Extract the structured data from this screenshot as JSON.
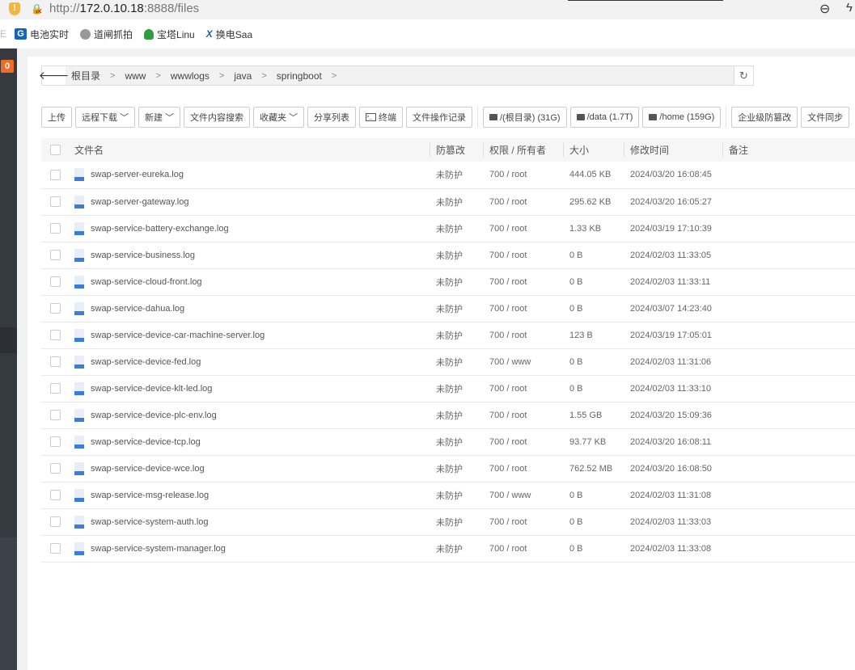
{
  "browser": {
    "url_prefix": "http://",
    "url_host": "172.0.10.18",
    "url_rest": ":8888/files",
    "bookmarks": [
      {
        "label": "电池实时",
        "icon": "g-logo"
      },
      {
        "label": "道闸抓拍",
        "icon": "globe-icon"
      },
      {
        "label": "宝塔Linu",
        "icon": "bt-icon"
      },
      {
        "label": "换电Saa",
        "icon": "x-logo"
      }
    ],
    "bookmark_cut": "E"
  },
  "sidebar": {
    "badge": "0"
  },
  "breadcrumb": [
    "根目录",
    "www",
    "wwwlogs",
    "java",
    "springboot"
  ],
  "toolbar": {
    "upload": "上传",
    "remote_download": "远程下载",
    "new": "新建",
    "content_search": "文件内容搜索",
    "favorites": "收藏夹",
    "share_list": "分享列表",
    "terminal": "终端",
    "op_log": "文件操作记录",
    "disks": [
      "/(根目录) (31G)",
      "/data (1.7T)",
      "/home (159G)"
    ],
    "tamper": "企业级防篡改",
    "sync": "文件同步"
  },
  "table": {
    "headers": [
      "文件名",
      "防篡改",
      "权限 / 所有者",
      "大小",
      "修改时间",
      "备注"
    ],
    "rows": [
      [
        "swap-server-eureka.log",
        "未防护",
        "700 / root",
        "444.05 KB",
        "2024/03/20 16:08:45"
      ],
      [
        "swap-server-gateway.log",
        "未防护",
        "700 / root",
        "295.62 KB",
        "2024/03/20 16:05:27"
      ],
      [
        "swap-service-battery-exchange.log",
        "未防护",
        "700 / root",
        "1.33 KB",
        "2024/03/19 17:10:39"
      ],
      [
        "swap-service-business.log",
        "未防护",
        "700 / root",
        "0 B",
        "2024/02/03 11:33:05"
      ],
      [
        "swap-service-cloud-front.log",
        "未防护",
        "700 / root",
        "0 B",
        "2024/02/03 11:33:11"
      ],
      [
        "swap-service-dahua.log",
        "未防护",
        "700 / root",
        "0 B",
        "2024/03/07 14:23:40"
      ],
      [
        "swap-service-device-car-machine-server.log",
        "未防护",
        "700 / root",
        "123 B",
        "2024/03/19 17:05:01"
      ],
      [
        "swap-service-device-fed.log",
        "未防护",
        "700 / www",
        "0 B",
        "2024/02/03 11:31:06"
      ],
      [
        "swap-service-device-klt-led.log",
        "未防护",
        "700 / root",
        "0 B",
        "2024/02/03 11:33:10"
      ],
      [
        "swap-service-device-plc-env.log",
        "未防护",
        "700 / root",
        "1.55 GB",
        "2024/03/20 15:09:36"
      ],
      [
        "swap-service-device-tcp.log",
        "未防护",
        "700 / root",
        "93.77 KB",
        "2024/03/20 16:08:11"
      ],
      [
        "swap-service-device-wce.log",
        "未防护",
        "700 / root",
        "762.52 MB",
        "2024/03/20 16:08:50"
      ],
      [
        "swap-service-msg-release.log",
        "未防护",
        "700 / www",
        "0 B",
        "2024/02/03 11:31:08"
      ],
      [
        "swap-service-system-auth.log",
        "未防护",
        "700 / root",
        "0 B",
        "2024/02/03 11:33:03"
      ],
      [
        "swap-service-system-manager.log",
        "未防护",
        "700 / root",
        "0 B",
        "2024/02/03 11:33:08"
      ]
    ]
  }
}
